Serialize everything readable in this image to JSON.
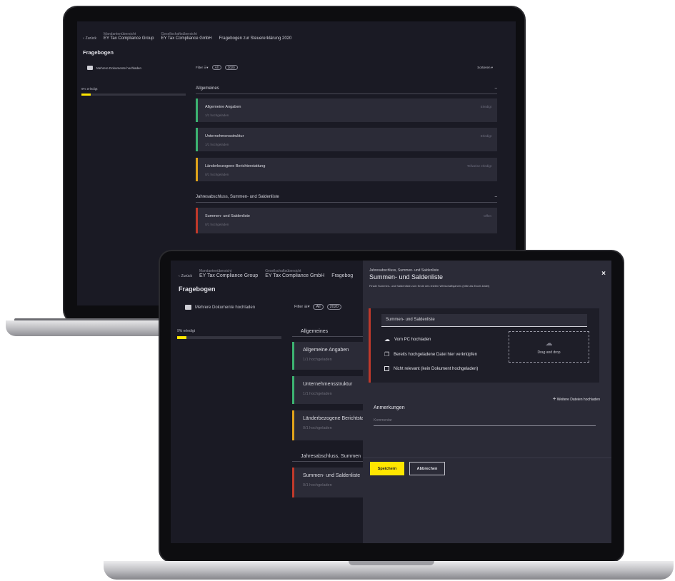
{
  "back_screen": {
    "back_label": "Zurück",
    "crumbs": [
      {
        "small": "Mandantenübersicht",
        "big": "EY Tax Compliance Group"
      },
      {
        "small": "Gesellschaftsübersicht",
        "big": "EY Tax Compliance GmbH"
      }
    ],
    "crumb_title": "Fragebogen zur Steuererklärung 2020",
    "page_title": "Fragebogen",
    "upload_label": "Mehrere Dokumente hochladen",
    "filter_label": "Filter",
    "filter_pills": [
      "All",
      "2020"
    ],
    "sort_label": "Sortieren",
    "progress_label": "9% erledigt",
    "progress": 0.09,
    "sections": [
      {
        "title": "Allgemeines",
        "toggle": "–"
      },
      {
        "title": "Jahresabschluss, Summen- und Saldenliste",
        "toggle": "–"
      }
    ],
    "cards": [
      {
        "title": "Allgemeine Angaben",
        "sub": "1/1 hochgeladen",
        "status": "Erledigt",
        "color": "#3cb371"
      },
      {
        "title": "Unternehmensstruktur",
        "sub": "1/1 hochgeladen",
        "status": "Erledigt",
        "color": "#3cb371"
      },
      {
        "title": "Länderbezogene Berichterstattung",
        "sub": "0/1 hochgeladen",
        "status": "Teilweise erledigt",
        "color": "#e0a31a"
      },
      {
        "title": "Summen- und Saldenliste",
        "sub": "0/1 hochgeladen",
        "status": "Offen",
        "color": "#c0392b"
      }
    ]
  },
  "front_screen": {
    "back_label": "Zurück",
    "crumbs": [
      {
        "small": "Mandantenübersicht",
        "big": "EY Tax Compliance Group"
      },
      {
        "small": "Gesellschaftsübersicht",
        "big": "EY Tax Compliance GmbH"
      }
    ],
    "crumb_title": "Fragebog",
    "page_title": "Fragebogen",
    "upload_label": "Mehrere Dokumente hochladen",
    "filter_label": "Filter",
    "filter_pills": [
      "All",
      "2020"
    ],
    "progress_label": "9% erledigt",
    "progress": 0.09,
    "sections": [
      {
        "title": "Allgemeines"
      },
      {
        "title": "Jahresabschluss, Summen"
      }
    ],
    "cards": [
      {
        "title": "Allgemeine Angaben",
        "sub": "1/1 hochgeladen",
        "color": "#3cb371"
      },
      {
        "title": "Unternehmensstruktur",
        "sub": "1/1 hochgeladen",
        "color": "#3cb371"
      },
      {
        "title": "Länderbezogene Berichtsta",
        "sub": "0/1 hochgeladen",
        "color": "#e0a31a"
      },
      {
        "title": "Summen- und Saldenliste",
        "sub": "0/1 hochgeladen",
        "color": "#c0392b"
      }
    ]
  },
  "modal": {
    "subtitle": "Jahresabschluss, Summen- und Saldenliste",
    "title": "Summen- und Saldenliste",
    "description": "Finale Summen- und Saldenliste zum Ende des letzten Wirtschaftsjahres (bitte als Excel-Datei)",
    "close": "×",
    "document_name": "Summen- und Saldenliste",
    "option_pc": "Vom PC hochladen",
    "option_link": "Bereits hochgeladene Datei hier verknüpfen",
    "option_not_relevant": "Nicht relevant (kein Dokument hochgeladen)",
    "dropzone_label": "Drag and drop",
    "add_more": "Weitere Dateien hochladen",
    "notes_label": "Anmerkungen",
    "notes_placeholder": "Kommentar",
    "save": "Speichern",
    "cancel": "Abbrechen"
  },
  "colors": {
    "accent": "#ffe600",
    "done": "#3cb371",
    "partial": "#e0a31a",
    "open": "#c0392b"
  }
}
